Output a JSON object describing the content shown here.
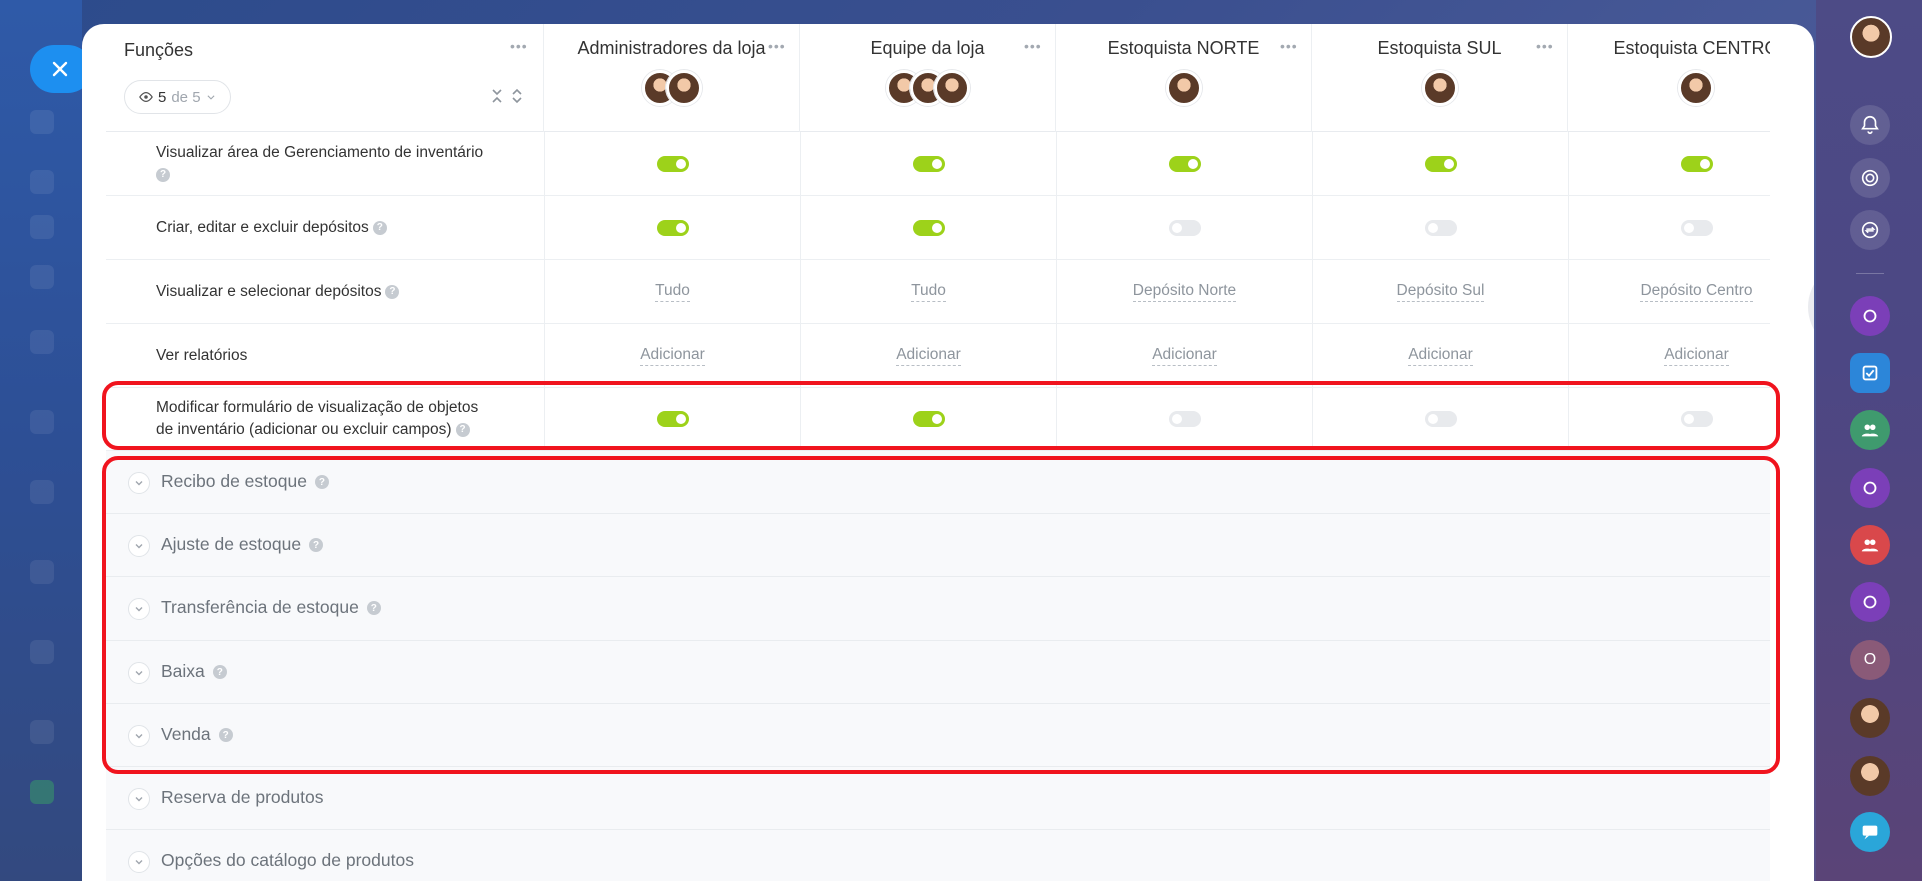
{
  "header": {
    "section_title": "Funções",
    "filter": {
      "count": "5",
      "separator": "de 5"
    },
    "roles": [
      {
        "name": "Administradores da loja"
      },
      {
        "name": "Equipe da loja"
      },
      {
        "name": "Estoquista NORTE"
      },
      {
        "name": "Estoquista SUL"
      },
      {
        "name": "Estoquista CENTRO"
      }
    ]
  },
  "rows": [
    {
      "label": "Visualizar área de Gerenciamento de inventário",
      "type": "toggle",
      "values": [
        true,
        true,
        true,
        true,
        true
      ]
    },
    {
      "label": "Criar, editar e excluir depósitos",
      "type": "toggle",
      "values": [
        true,
        true,
        false,
        false,
        false
      ]
    },
    {
      "label": "Visualizar e selecionar depósitos",
      "type": "text",
      "values": [
        "Tudo",
        "Tudo",
        "Depósito Norte",
        "Depósito Sul",
        "Depósito Centro"
      ]
    },
    {
      "label": "Ver relatórios",
      "type": "text",
      "values": [
        "Adicionar",
        "Adicionar",
        "Adicionar",
        "Adicionar",
        "Adicionar"
      ]
    },
    {
      "label_line1": "Modificar formulário de visualização de objetos",
      "label_line2": "de inventário (adicionar ou excluir campos)",
      "type": "toggle",
      "values": [
        true,
        true,
        false,
        false,
        false
      ]
    }
  ],
  "sections": [
    {
      "title": "Recibo de estoque"
    },
    {
      "title": "Ajuste de estoque"
    },
    {
      "title": "Transferência de estoque"
    },
    {
      "title": "Baixa"
    },
    {
      "title": "Venda"
    },
    {
      "title": "Reserva de produtos"
    },
    {
      "title": "Opções do catálogo de produtos"
    }
  ],
  "right_sidebar": {
    "status_initial": "O"
  },
  "colors": {
    "toggle_on": "#9dd21a",
    "toggle_off": "#e8eaed",
    "highlight": "#f0141e",
    "close_button": "#1d8ff0"
  }
}
